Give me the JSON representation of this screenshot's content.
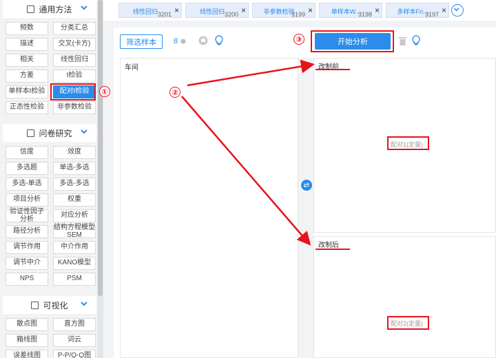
{
  "sidebar": {
    "sections": [
      {
        "title": "通用方法",
        "icon": "folder-icon"
      },
      {
        "title": "问卷研究",
        "icon": "document-icon"
      },
      {
        "title": "可视化",
        "icon": "chart-icon"
      }
    ],
    "general": [
      "频数",
      "分类汇总",
      "描述",
      "交叉(卡方)",
      "相关",
      "线性回归",
      "方差",
      "t检验",
      "单样本t检验",
      "配对t检验",
      "正态性检验",
      "非参数检验"
    ],
    "survey": [
      "信度",
      "效度",
      "多选题",
      "单选-多选",
      "多选-单选",
      "多选-多选",
      "项目分析",
      "权重",
      "验证性因子\n分析",
      "对应分析",
      "路径分析",
      "结构方程模型\nSEM",
      "调节作用",
      "中介作用",
      "调节中介",
      "KANO模型",
      "NPS",
      "PSM"
    ],
    "viz": [
      "散点图",
      "直方图",
      "箱线图",
      "词云",
      "误差线图",
      "P-P/Q-Q图"
    ]
  },
  "tabs": [
    {
      "label": "线性回归",
      "num": "3201"
    },
    {
      "label": "线性回归",
      "num": "3200"
    },
    {
      "label": "非参数检验",
      "num": "3199"
    },
    {
      "label": "单样本W...",
      "num": "3198"
    },
    {
      "label": "多样本Fri...",
      "num": "3197"
    }
  ],
  "toolbar": {
    "filter_label": "筛选样本",
    "count": "8",
    "start_label": "开始分析"
  },
  "variables": {
    "title": "车间"
  },
  "pairs": [
    {
      "title": "改制前",
      "placeholder": "配对1(定量)"
    },
    {
      "title": "改制后",
      "placeholder": "配对2(定量)"
    }
  ],
  "annotations": [
    "①",
    "②",
    "③"
  ],
  "colors": {
    "accent": "#2b8ceb",
    "annotation": "#e8121a"
  }
}
